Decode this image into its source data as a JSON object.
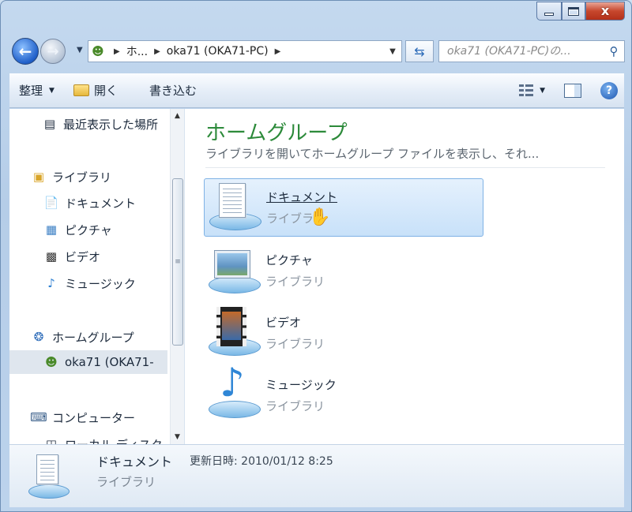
{
  "window": {
    "close_glyph": "x"
  },
  "nav": {
    "address_crumbs": [
      "ホ...",
      "oka71 (OKA71-PC)"
    ],
    "search_placeholder": "oka71 (OKA71-PC)の..."
  },
  "toolbar": {
    "organize_label": "整理",
    "open_label": "開く",
    "burn_label": "書き込む"
  },
  "sidebar": {
    "items": [
      {
        "label": "最近表示した場所",
        "icon": "recent-places-icon"
      },
      {
        "label": "ライブラリ",
        "icon": "library-icon"
      },
      {
        "label": "ドキュメント",
        "icon": "document-icon"
      },
      {
        "label": "ピクチャ",
        "icon": "picture-icon"
      },
      {
        "label": "ビデオ",
        "icon": "video-icon"
      },
      {
        "label": "ミュージック",
        "icon": "music-icon"
      },
      {
        "label": "ホームグループ",
        "icon": "homegroup-icon"
      },
      {
        "label": "oka71 (OKA71-",
        "icon": "user-icon"
      },
      {
        "label": "コンピューター",
        "icon": "computer-icon"
      },
      {
        "label": "ローカル ディスク",
        "icon": "disk-icon"
      }
    ],
    "selected_index": 7
  },
  "main": {
    "title": "ホームグループ",
    "description": "ライブラリを開いてホームグループ ファイルを表示し、それ...",
    "libraries": [
      {
        "name": "ドキュメント",
        "type": "ライブラリ",
        "icon": "document-library-icon"
      },
      {
        "name": "ピクチャ",
        "type": "ライブラリ",
        "icon": "picture-library-icon"
      },
      {
        "name": "ビデオ",
        "type": "ライブラリ",
        "icon": "video-library-icon"
      },
      {
        "name": "ミュージック",
        "type": "ライブラリ",
        "icon": "music-library-icon"
      }
    ],
    "hovered_index": 0
  },
  "details": {
    "name": "ドキュメント",
    "modified": "更新日時: 2010/01/12 8:25",
    "type": "ライブラリ"
  }
}
